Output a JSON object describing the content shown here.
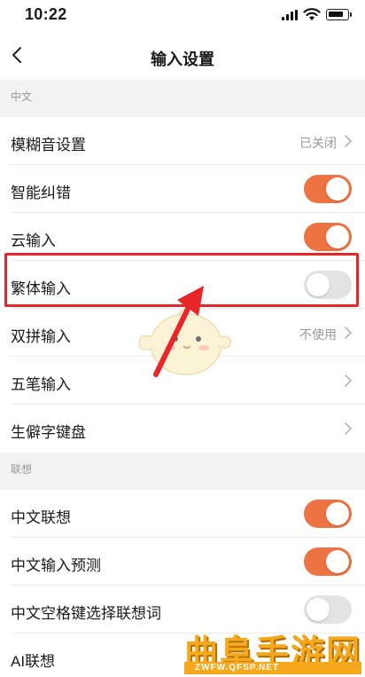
{
  "status_bar": {
    "time": "10:22"
  },
  "header": {
    "title": "输入设置"
  },
  "sections": [
    {
      "label": "中文",
      "rows": [
        {
          "label": "模糊音设置",
          "value": "已关闭"
        },
        {
          "label": "智能纠错",
          "toggle": "on"
        },
        {
          "label": "云输入",
          "toggle": "on"
        },
        {
          "label": "繁体输入",
          "toggle": "off"
        },
        {
          "label": "双拼输入",
          "value": "不使用"
        },
        {
          "label": "五笔输入"
        },
        {
          "label": "生僻字键盘"
        }
      ]
    },
    {
      "label": "联想",
      "rows": [
        {
          "label": "中文联想",
          "toggle": "on"
        },
        {
          "label": "中文输入预测",
          "toggle": "on"
        },
        {
          "label": "中文空格键选择联想词",
          "toggle": "off"
        },
        {
          "label": "AI联想"
        }
      ]
    }
  ],
  "watermark": {
    "title": "曲阜手游网",
    "url": "ZWFW.QFSP.NET"
  },
  "colors": {
    "toggle_on": "#ee7342",
    "toggle_off": "#e3e3e3",
    "highlight": "#e8262a"
  }
}
